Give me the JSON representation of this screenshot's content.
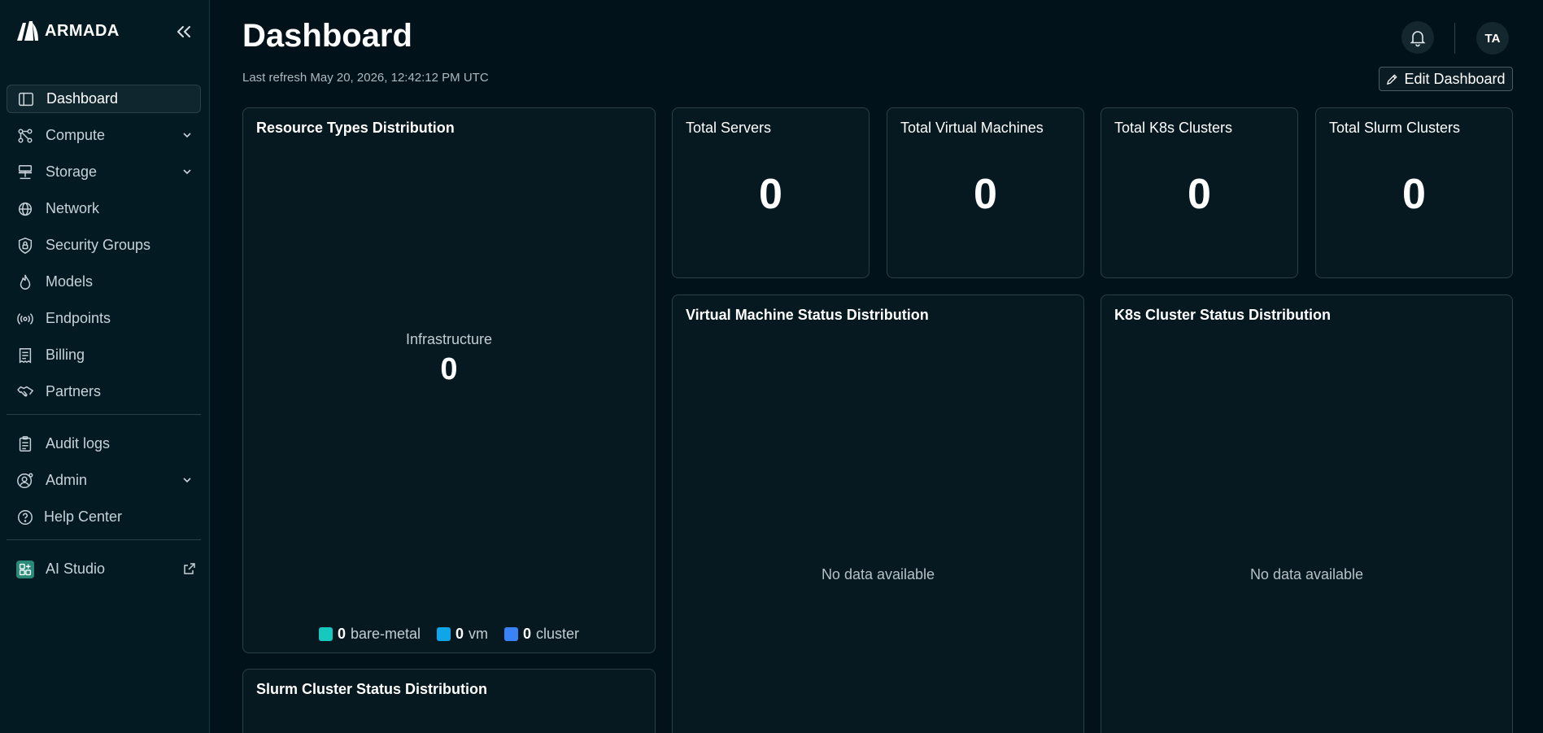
{
  "sidebar": {
    "brand": "ARMADA",
    "items": [
      {
        "label": "Dashboard"
      },
      {
        "label": "Compute"
      },
      {
        "label": "Storage"
      },
      {
        "label": "Network"
      },
      {
        "label": "Security Groups"
      },
      {
        "label": "Models"
      },
      {
        "label": "Endpoints"
      },
      {
        "label": "Billing"
      },
      {
        "label": "Partners"
      }
    ],
    "secondary": [
      {
        "label": "Audit logs"
      },
      {
        "label": "Admin"
      },
      {
        "label": "Help Center"
      }
    ],
    "apps": [
      {
        "label": "AI Studio"
      }
    ]
  },
  "header": {
    "title": "Dashboard",
    "last_refresh": "Last refresh May 20, 2026, 12:42:12 PM UTC",
    "avatar_initials": "TA",
    "edit_label": "Edit Dashboard"
  },
  "resource_card": {
    "title": "Resource Types Distribution",
    "center_label": "Infrastructure",
    "center_value": "0",
    "legend": [
      {
        "count": "0",
        "label": "bare-metal",
        "color": "#16c8c0"
      },
      {
        "count": "0",
        "label": "vm",
        "color": "#0ea5e9"
      },
      {
        "count": "0",
        "label": "cluster",
        "color": "#3b82f6"
      }
    ]
  },
  "stats": [
    {
      "title": "Total Servers",
      "value": "0"
    },
    {
      "title": "Total Virtual Machines",
      "value": "0"
    },
    {
      "title": "Total K8s Clusters",
      "value": "0"
    },
    {
      "title": "Total Slurm Clusters",
      "value": "0"
    }
  ],
  "vm_status": {
    "title": "Virtual Machine Status Distribution",
    "empty": "No data available"
  },
  "k8s_status": {
    "title": "K8s Cluster Status Distribution",
    "empty": "No data available"
  },
  "slurm_status": {
    "title": "Slurm Cluster Status Distribution"
  },
  "colors": {
    "background": "#02121a",
    "sidebar": "#041a23",
    "card_border": "#2c3f49"
  }
}
